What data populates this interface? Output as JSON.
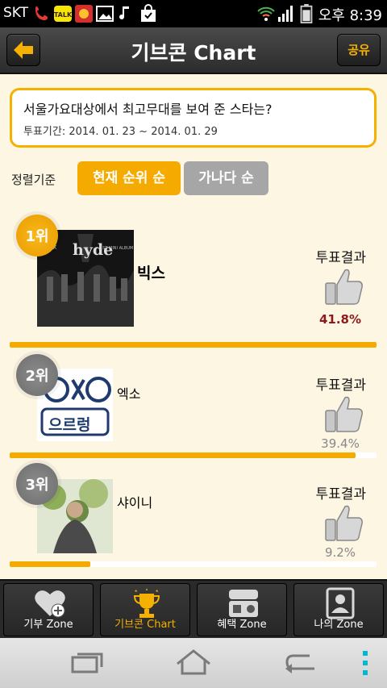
{
  "status_bar": {
    "carrier": "SKT",
    "time": "오후 8:39"
  },
  "header": {
    "title": "기브콘 Chart",
    "share_label": "공유"
  },
  "poll": {
    "question": "서울가요대상에서 최고무대를 보여 준 스타는?",
    "period": "투표기간: 2014. 01. 23 ~ 2014. 01. 29"
  },
  "sort": {
    "label": "정렬기준",
    "current_rank": "현재 순위 순",
    "alphabetical": "가나다 순"
  },
  "ranking": [
    {
      "rank": "1위",
      "artist": "빅스",
      "vote_label": "투표결과",
      "percent": "41.8%",
      "percent_value": 41.8,
      "album_text": "hyde",
      "album_sub": "VIXX",
      "album_sub2": "1ST MINI ALBUM"
    },
    {
      "rank": "2위",
      "artist": "엑소",
      "vote_label": "투표결과",
      "percent": "39.4%",
      "percent_value": 39.4,
      "album_text": "으르렁"
    },
    {
      "rank": "3위",
      "artist": "샤이니",
      "vote_label": "투표결과",
      "percent": "9.2%",
      "percent_value": 9.2
    }
  ],
  "bottom_nav": {
    "items": [
      {
        "label": "기부 Zone",
        "icon": "heart-plus-icon"
      },
      {
        "label": "기브콘 Chart",
        "icon": "trophy-icon"
      },
      {
        "label": "혜택 Zone",
        "icon": "coupon-icon"
      },
      {
        "label": "나의 Zone",
        "icon": "profile-icon"
      }
    ]
  },
  "colors": {
    "accent": "#f5aa00",
    "header": "#333333",
    "background": "#fdf6e3",
    "first_percent": "#8b1a1a",
    "other_percent": "#888888"
  }
}
